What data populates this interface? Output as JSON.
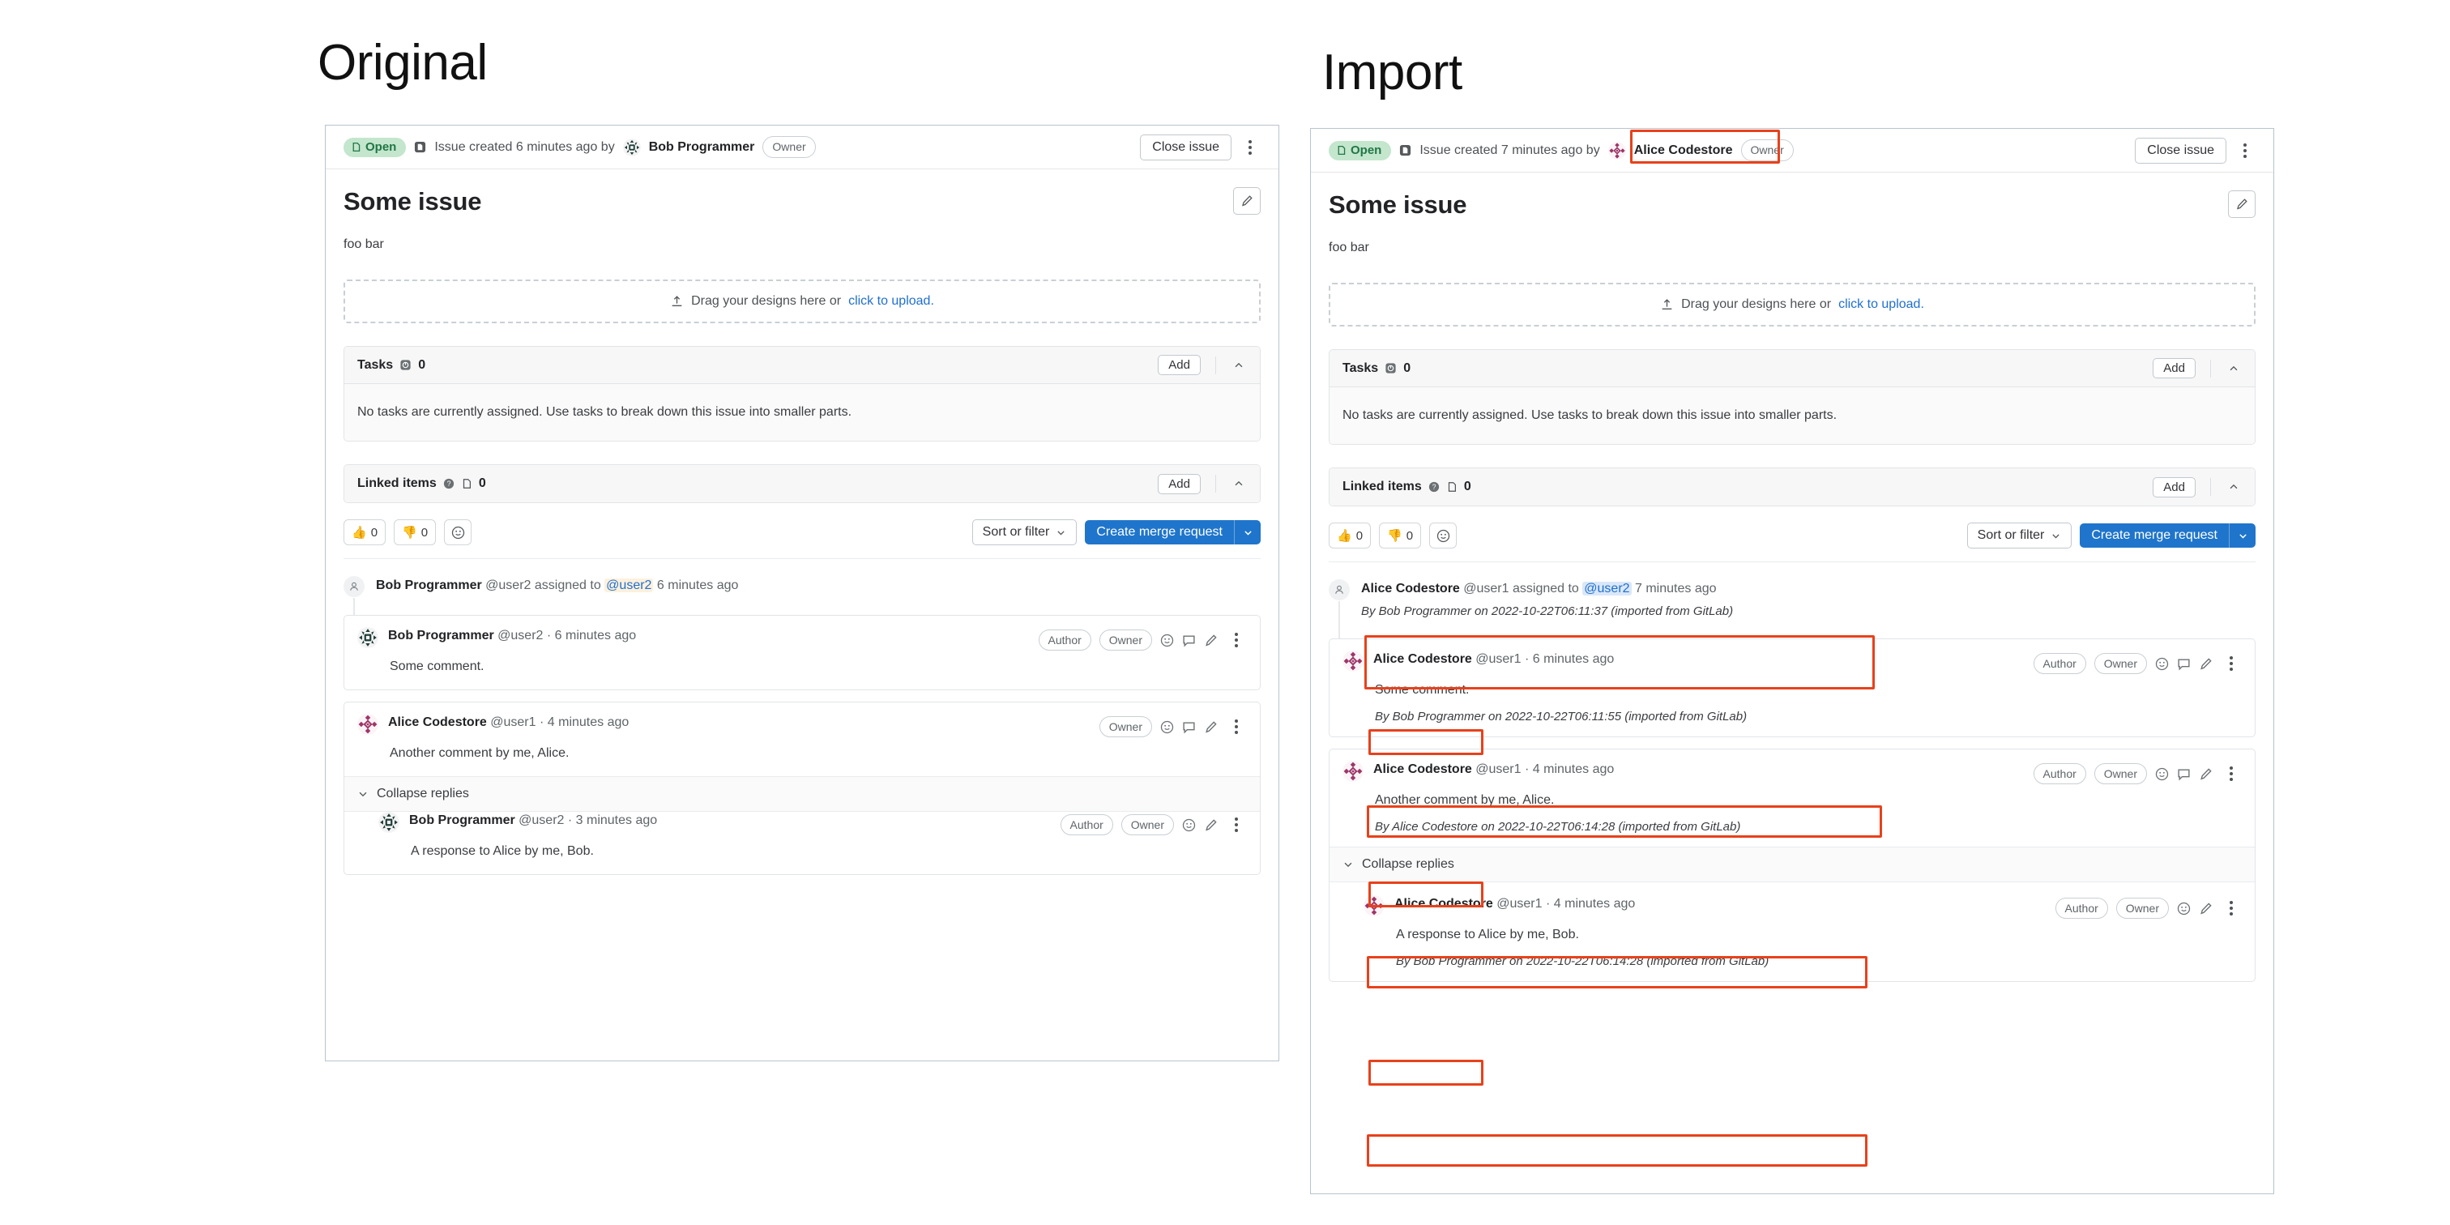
{
  "labels": {
    "original": "Original",
    "import": "Import"
  },
  "common": {
    "status_badge": "Open",
    "owner_pill": "Owner",
    "author_pill": "Author",
    "close_issue": "Close issue",
    "title": "Some issue",
    "description": "foo bar",
    "dropzone_text": "Drag your designs here or",
    "dropzone_link": "click to upload.",
    "tasks_label": "Tasks",
    "tasks_count": "0",
    "tasks_empty": "No tasks are currently assigned. Use tasks to break down this issue into smaller parts.",
    "linked_label": "Linked items",
    "linked_count": "0",
    "add_label": "Add",
    "thumbs_up_count": "0",
    "thumbs_down_count": "0",
    "sort_or_filter": "Sort or filter",
    "create_mr": "Create merge request",
    "collapse_replies": "Collapse replies",
    "accent_blue": "#1f75cb",
    "annotation_red": "#e8411b",
    "open_green_bg": "#c3e6cd",
    "open_green_fg": "#217645"
  },
  "original": {
    "header": {
      "created_text": "Issue created 6 minutes ago by",
      "author": "Bob Programmer"
    },
    "system_note": {
      "author": "Bob Programmer",
      "handle": "@user2",
      "action": "assigned to",
      "mention": "@user2",
      "time": "6 minutes ago"
    },
    "notes": [
      {
        "author": "Bob Programmer",
        "handle": "@user2",
        "time": "6 minutes ago",
        "body": "Some comment.",
        "badges": [
          "Author",
          "Owner"
        ],
        "avatar": "bob"
      },
      {
        "author": "Alice Codestore",
        "handle": "@user1",
        "time": "4 minutes ago",
        "body": "Another comment by me, Alice.",
        "badges": [
          "Owner"
        ],
        "avatar": "alice"
      },
      {
        "author": "Bob Programmer",
        "handle": "@user2",
        "time": "3 minutes ago",
        "body": "A response to Alice by me, Bob.",
        "badges": [
          "Author",
          "Owner"
        ],
        "avatar": "bob"
      }
    ]
  },
  "import": {
    "header": {
      "created_text": "Issue created 7 minutes ago by",
      "author": "Alice Codestore"
    },
    "system_note": {
      "author": "Alice Codestore",
      "handle": "@user1",
      "action": "assigned to",
      "mention": "@user2",
      "time": "7 minutes ago",
      "imported": "By Bob Programmer on 2022-10-22T06:11:37 (imported from GitLab)"
    },
    "notes": [
      {
        "author": "Alice Codestore",
        "handle": "@user1",
        "time": "6 minutes ago",
        "body": "Some comment.",
        "imported": "By Bob Programmer on 2022-10-22T06:11:55 (imported from GitLab)",
        "badges": [
          "Author",
          "Owner"
        ],
        "avatar": "alice"
      },
      {
        "author": "Alice Codestore",
        "handle": "@user1",
        "time": "4 minutes ago",
        "body": "Another comment by me, Alice.",
        "imported": "By Alice Codestore on 2022-10-22T06:14:28 (imported from GitLab)",
        "badges": [
          "Author",
          "Owner"
        ],
        "avatar": "alice"
      },
      {
        "author": "Alice Codestore",
        "handle": "@user1",
        "time": "4 minutes ago",
        "body": "A response to Alice by me, Bob.",
        "imported": "By Bob Programmer on 2022-10-22T06:14:28 (imported from GitLab)",
        "badges": [
          "Author",
          "Owner"
        ],
        "avatar": "alice"
      }
    ]
  },
  "icons": {
    "issue": "issue-icon",
    "open_status": "open-status-icon",
    "kebab": "kebab-menu-icon",
    "edit": "pencil-icon",
    "upload": "upload-icon",
    "task": "task-icon",
    "help": "help-circle-icon",
    "linked": "linked-item-icon",
    "chevron_up": "chevron-up-icon",
    "chevron_down": "chevron-down-icon",
    "emoji": "emoji-smiley-icon",
    "reply": "reply-bubble-icon",
    "thumbs_up": "thumbs-up-icon",
    "thumbs_down": "thumbs-down-icon",
    "user": "user-silhouette-icon"
  }
}
